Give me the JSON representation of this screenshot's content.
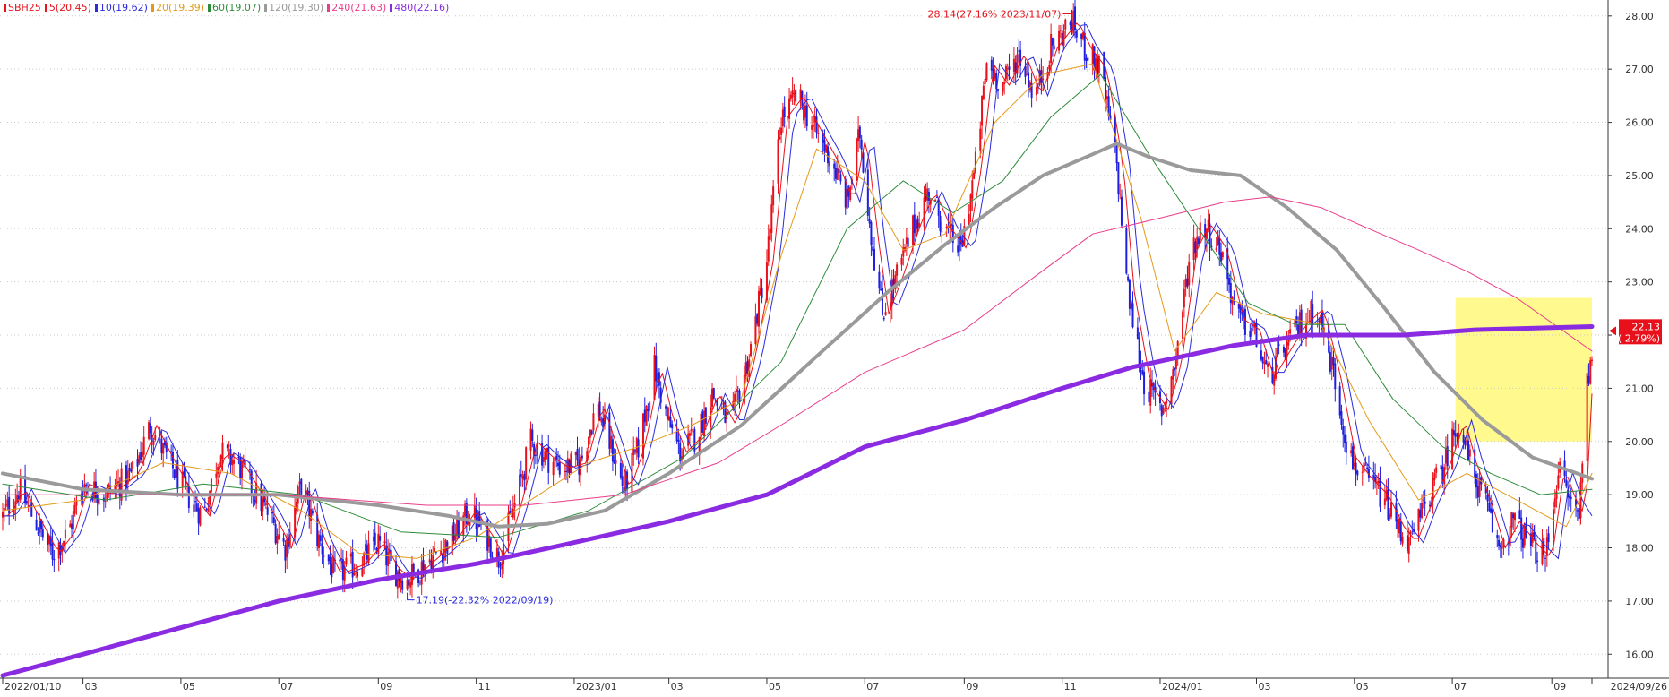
{
  "chart_data": {
    "type": "candlestick",
    "symbol": "SBH25",
    "legend": [
      {
        "label": "SBH25",
        "color": "#e8101a"
      },
      {
        "label": "5(20.45)",
        "color": "#e8101a"
      },
      {
        "label": "10(19.62)",
        "color": "#2b2bdc"
      },
      {
        "label": "20(19.39)",
        "color": "#e39a1b"
      },
      {
        "label": "60(19.07)",
        "color": "#2e8b3a"
      },
      {
        "label": "120(19.30)",
        "color": "#9a9a9a"
      },
      {
        "label": "240(21.63)",
        "color": "#ea3d8a"
      },
      {
        "label": "480(22.16)",
        "color": "#8a2be2"
      }
    ],
    "x_range": [
      "2022-01-10",
      "2024-09-26"
    ],
    "ylim": [
      15.55,
      28.3
    ],
    "y_ticks": [
      "16.00",
      "17.00",
      "18.00",
      "19.00",
      "20.00",
      "21.00",
      "22.00",
      "23.00",
      "24.00",
      "25.00",
      "26.00",
      "27.00",
      "28.00"
    ],
    "x_ticks": [
      {
        "label": "2022/01/10",
        "date": "2022-01-10"
      },
      {
        "label": "03",
        "date": "2022-03-01"
      },
      {
        "label": "05",
        "date": "2022-05-01"
      },
      {
        "label": "07",
        "date": "2022-07-01"
      },
      {
        "label": "09",
        "date": "2022-09-01"
      },
      {
        "label": "11",
        "date": "2022-11-01"
      },
      {
        "label": "2023/01",
        "date": "2023-01-01"
      },
      {
        "label": "03",
        "date": "2023-03-01"
      },
      {
        "label": "05",
        "date": "2023-05-01"
      },
      {
        "label": "07",
        "date": "2023-07-01"
      },
      {
        "label": "09",
        "date": "2023-09-01"
      },
      {
        "label": "11",
        "date": "2023-11-01"
      },
      {
        "label": "2024/01",
        "date": "2024-01-01"
      },
      {
        "label": "03",
        "date": "2024-03-01"
      },
      {
        "label": "05",
        "date": "2024-05-01"
      },
      {
        "label": "07",
        "date": "2024-07-01"
      },
      {
        "label": "09",
        "date": "2024-09-01"
      },
      {
        "label": "2024/09/26",
        "date": "2024-09-26"
      }
    ],
    "price_path": [
      [
        "2022-01-10",
        18.6
      ],
      [
        "2022-01-20",
        19.1
      ],
      [
        "2022-02-01",
        18.4
      ],
      [
        "2022-02-10",
        17.9
      ],
      [
        "2022-02-20",
        18.3
      ],
      [
        "2022-03-01",
        19.2
      ],
      [
        "2022-03-15",
        19.0
      ],
      [
        "2022-04-01",
        19.4
      ],
      [
        "2022-04-12",
        20.3
      ],
      [
        "2022-04-22",
        19.7
      ],
      [
        "2022-05-05",
        19.0
      ],
      [
        "2022-05-15",
        18.6
      ],
      [
        "2022-05-25",
        19.8
      ],
      [
        "2022-06-05",
        19.6
      ],
      [
        "2022-06-15",
        19.1
      ],
      [
        "2022-06-25",
        18.6
      ],
      [
        "2022-07-05",
        18.0
      ],
      [
        "2022-07-15",
        19.2
      ],
      [
        "2022-07-25",
        18.2
      ],
      [
        "2022-08-05",
        17.5
      ],
      [
        "2022-08-20",
        17.7
      ],
      [
        "2022-09-01",
        18.1
      ],
      [
        "2022-09-10",
        17.6
      ],
      [
        "2022-09-19",
        17.4
      ],
      [
        "2022-09-30",
        17.7
      ],
      [
        "2022-10-15",
        18.1
      ],
      [
        "2022-10-28",
        18.7
      ],
      [
        "2022-11-08",
        18.2
      ],
      [
        "2022-11-15",
        17.8
      ],
      [
        "2022-11-25",
        18.8
      ],
      [
        "2022-12-05",
        20.0
      ],
      [
        "2022-12-15",
        19.7
      ],
      [
        "2022-12-25",
        19.5
      ],
      [
        "2023-01-05",
        19.6
      ],
      [
        "2023-01-15",
        20.7
      ],
      [
        "2023-01-25",
        19.8
      ],
      [
        "2023-02-01",
        19.1
      ],
      [
        "2023-02-10",
        19.9
      ],
      [
        "2023-02-20",
        21.4
      ],
      [
        "2023-02-28",
        20.4
      ],
      [
        "2023-03-08",
        19.8
      ],
      [
        "2023-03-18",
        20.1
      ],
      [
        "2023-03-28",
        20.9
      ],
      [
        "2023-04-08",
        20.3
      ],
      [
        "2023-04-20",
        21.6
      ],
      [
        "2023-05-01",
        23.4
      ],
      [
        "2023-05-10",
        26.1
      ],
      [
        "2023-05-20",
        26.5
      ],
      [
        "2023-05-30",
        25.9
      ],
      [
        "2023-06-10",
        25.3
      ],
      [
        "2023-06-20",
        24.5
      ],
      [
        "2023-06-28",
        25.8
      ],
      [
        "2023-07-05",
        23.9
      ],
      [
        "2023-07-12",
        22.4
      ],
      [
        "2023-07-22",
        23.2
      ],
      [
        "2023-08-01",
        24.1
      ],
      [
        "2023-08-10",
        24.7
      ],
      [
        "2023-08-20",
        24.0
      ],
      [
        "2023-08-30",
        23.6
      ],
      [
        "2023-09-08",
        25.2
      ],
      [
        "2023-09-15",
        27.1
      ],
      [
        "2023-09-25",
        26.7
      ],
      [
        "2023-10-05",
        27.3
      ],
      [
        "2023-10-15",
        26.5
      ],
      [
        "2023-10-25",
        27.4
      ],
      [
        "2023-11-07",
        27.9
      ],
      [
        "2023-11-15",
        27.4
      ],
      [
        "2023-11-25",
        27.0
      ],
      [
        "2023-12-05",
        25.2
      ],
      [
        "2023-12-12",
        22.8
      ],
      [
        "2023-12-22",
        21.1
      ],
      [
        "2024-01-02",
        20.6
      ],
      [
        "2024-01-10",
        21.4
      ],
      [
        "2024-01-20",
        23.6
      ],
      [
        "2024-01-28",
        24.1
      ],
      [
        "2024-02-08",
        23.6
      ],
      [
        "2024-02-18",
        22.3
      ],
      [
        "2024-02-28",
        22.1
      ],
      [
        "2024-03-08",
        21.2
      ],
      [
        "2024-03-18",
        21.7
      ],
      [
        "2024-03-28",
        22.2
      ],
      [
        "2024-04-08",
        22.5
      ],
      [
        "2024-04-18",
        21.3
      ],
      [
        "2024-04-28",
        19.7
      ],
      [
        "2024-05-08",
        19.3
      ],
      [
        "2024-05-18",
        19.0
      ],
      [
        "2024-05-28",
        18.4
      ],
      [
        "2024-06-05",
        18.1
      ],
      [
        "2024-06-15",
        18.9
      ],
      [
        "2024-06-25",
        19.5
      ],
      [
        "2024-07-05",
        20.4
      ],
      [
        "2024-07-12",
        19.6
      ],
      [
        "2024-07-22",
        18.8
      ],
      [
        "2024-07-30",
        18.0
      ],
      [
        "2024-08-08",
        18.5
      ],
      [
        "2024-08-18",
        18.1
      ],
      [
        "2024-08-28",
        17.8
      ],
      [
        "2024-09-05",
        19.5
      ],
      [
        "2024-09-12",
        18.9
      ],
      [
        "2024-09-18",
        18.6
      ],
      [
        "2024-09-22",
        20.9
      ],
      [
        "2024-09-26",
        21.8
      ]
    ],
    "moving_averages": [
      {
        "name": "20",
        "color": "#e39a1b",
        "width": 1,
        "points": [
          [
            "2022-01-10",
            18.7
          ],
          [
            "2022-03-01",
            18.9
          ],
          [
            "2022-04-20",
            19.6
          ],
          [
            "2022-06-01",
            19.4
          ],
          [
            "2022-07-15",
            18.7
          ],
          [
            "2022-08-20",
            17.9
          ],
          [
            "2022-09-25",
            17.8
          ],
          [
            "2022-11-01",
            18.2
          ],
          [
            "2022-12-05",
            18.9
          ],
          [
            "2023-01-10",
            19.6
          ],
          [
            "2023-02-10",
            19.9
          ],
          [
            "2023-03-15",
            20.3
          ],
          [
            "2023-04-15",
            20.8
          ],
          [
            "2023-05-10",
            23.5
          ],
          [
            "2023-06-01",
            25.5
          ],
          [
            "2023-07-01",
            24.9
          ],
          [
            "2023-07-25",
            23.6
          ],
          [
            "2023-08-20",
            23.9
          ],
          [
            "2023-09-20",
            26.0
          ],
          [
            "2023-10-20",
            26.9
          ],
          [
            "2023-11-20",
            27.1
          ],
          [
            "2023-12-20",
            24.2
          ],
          [
            "2024-01-10",
            21.7
          ],
          [
            "2024-02-05",
            22.8
          ],
          [
            "2024-03-05",
            22.4
          ],
          [
            "2024-04-10",
            22.2
          ],
          [
            "2024-05-10",
            20.4
          ],
          [
            "2024-06-10",
            18.9
          ],
          [
            "2024-07-10",
            19.4
          ],
          [
            "2024-08-10",
            18.9
          ],
          [
            "2024-09-10",
            18.4
          ],
          [
            "2024-09-26",
            19.4
          ]
        ]
      },
      {
        "name": "60",
        "color": "#2e8b3a",
        "width": 1,
        "points": [
          [
            "2022-01-10",
            19.2
          ],
          [
            "2022-03-15",
            18.9
          ],
          [
            "2022-05-15",
            19.2
          ],
          [
            "2022-07-15",
            19.0
          ],
          [
            "2022-09-15",
            18.3
          ],
          [
            "2022-11-15",
            18.2
          ],
          [
            "2023-01-10",
            18.7
          ],
          [
            "2023-03-10",
            19.7
          ],
          [
            "2023-05-10",
            21.5
          ],
          [
            "2023-06-20",
            24.0
          ],
          [
            "2023-07-25",
            24.9
          ],
          [
            "2023-08-25",
            24.3
          ],
          [
            "2023-09-25",
            24.9
          ],
          [
            "2023-10-25",
            26.1
          ],
          [
            "2023-11-25",
            26.9
          ],
          [
            "2023-12-25",
            25.4
          ],
          [
            "2024-01-25",
            24.0
          ],
          [
            "2024-02-25",
            22.6
          ],
          [
            "2024-03-25",
            22.2
          ],
          [
            "2024-04-25",
            22.2
          ],
          [
            "2024-05-25",
            20.8
          ],
          [
            "2024-06-25",
            19.9
          ],
          [
            "2024-07-25",
            19.4
          ],
          [
            "2024-08-25",
            19.0
          ],
          [
            "2024-09-26",
            19.1
          ]
        ]
      },
      {
        "name": "120",
        "color": "#9a9a9a",
        "width": 4,
        "points": [
          [
            "2022-01-10",
            19.4
          ],
          [
            "2022-03-01",
            19.1
          ],
          [
            "2022-05-01",
            19.0
          ],
          [
            "2022-07-01",
            19.0
          ],
          [
            "2022-09-01",
            18.8
          ],
          [
            "2022-10-15",
            18.6
          ],
          [
            "2022-11-15",
            18.4
          ],
          [
            "2022-12-15",
            18.45
          ],
          [
            "2023-01-20",
            18.7
          ],
          [
            "2023-03-01",
            19.4
          ],
          [
            "2023-04-15",
            20.3
          ],
          [
            "2023-06-01",
            21.6
          ],
          [
            "2023-07-15",
            22.8
          ],
          [
            "2023-08-20",
            23.7
          ],
          [
            "2023-09-20",
            24.4
          ],
          [
            "2023-10-20",
            25.0
          ],
          [
            "2023-11-20",
            25.4
          ],
          [
            "2023-12-05",
            25.6
          ],
          [
            "2023-12-25",
            25.35
          ],
          [
            "2024-01-20",
            25.1
          ],
          [
            "2024-02-20",
            25.0
          ],
          [
            "2024-03-20",
            24.4
          ],
          [
            "2024-04-20",
            23.6
          ],
          [
            "2024-05-20",
            22.5
          ],
          [
            "2024-06-20",
            21.3
          ],
          [
            "2024-07-20",
            20.4
          ],
          [
            "2024-08-20",
            19.7
          ],
          [
            "2024-09-26",
            19.3
          ]
        ]
      },
      {
        "name": "240",
        "color": "#ea3d8a",
        "width": 1,
        "points": [
          [
            "2022-01-10",
            19.0
          ],
          [
            "2022-04-01",
            19.0
          ],
          [
            "2022-07-01",
            19.0
          ],
          [
            "2022-10-01",
            18.8
          ],
          [
            "2022-12-01",
            18.8
          ],
          [
            "2023-02-01",
            19.0
          ],
          [
            "2023-04-01",
            19.6
          ],
          [
            "2023-05-15",
            20.4
          ],
          [
            "2023-07-01",
            21.3
          ],
          [
            "2023-09-01",
            22.1
          ],
          [
            "2023-10-15",
            23.1
          ],
          [
            "2023-11-20",
            23.9
          ],
          [
            "2024-01-01",
            24.2
          ],
          [
            "2024-02-10",
            24.5
          ],
          [
            "2024-03-10",
            24.6
          ],
          [
            "2024-04-10",
            24.4
          ],
          [
            "2024-05-10",
            24.0
          ],
          [
            "2024-06-10",
            23.6
          ],
          [
            "2024-07-10",
            23.2
          ],
          [
            "2024-08-10",
            22.7
          ],
          [
            "2024-09-26",
            21.7
          ]
        ]
      },
      {
        "name": "480",
        "color": "#8a2be2",
        "width": 5,
        "points": [
          [
            "2022-01-10",
            15.6
          ],
          [
            "2022-03-01",
            16.0
          ],
          [
            "2022-05-01",
            16.5
          ],
          [
            "2022-07-01",
            17.0
          ],
          [
            "2022-09-01",
            17.4
          ],
          [
            "2022-11-01",
            17.7
          ],
          [
            "2023-01-01",
            18.1
          ],
          [
            "2023-03-01",
            18.5
          ],
          [
            "2023-05-01",
            19.0
          ],
          [
            "2023-07-01",
            19.9
          ],
          [
            "2023-09-01",
            20.4
          ],
          [
            "2023-11-01",
            21.0
          ],
          [
            "2023-12-15",
            21.4
          ],
          [
            "2024-01-15",
            21.6
          ],
          [
            "2024-02-15",
            21.8
          ],
          [
            "2024-04-01",
            22.0
          ],
          [
            "2024-06-01",
            22.0
          ],
          [
            "2024-07-15",
            22.1
          ],
          [
            "2024-09-26",
            22.16
          ]
        ]
      }
    ],
    "annotations": [
      {
        "text": "28.14(27.16% 2023/11/07)",
        "color": "#e8101a",
        "date": "2023-11-07",
        "value": 28.14,
        "side": "left-above"
      },
      {
        "text": "17.19(-22.32% 2022/09/19)",
        "color": "#2b2bdc",
        "date": "2022-09-19",
        "value": 17.19,
        "side": "right-below"
      }
    ],
    "highlight": {
      "color": "#fff87a",
      "from_date": "2024-07-03",
      "to_date": "2024-09-26",
      "from_value": 20.0,
      "to_value": 22.7
    },
    "last_price": {
      "value": "22.13",
      "change": "( 2.79%)",
      "color": "#e8101a"
    },
    "grid": true,
    "legend_position": "top-left"
  }
}
